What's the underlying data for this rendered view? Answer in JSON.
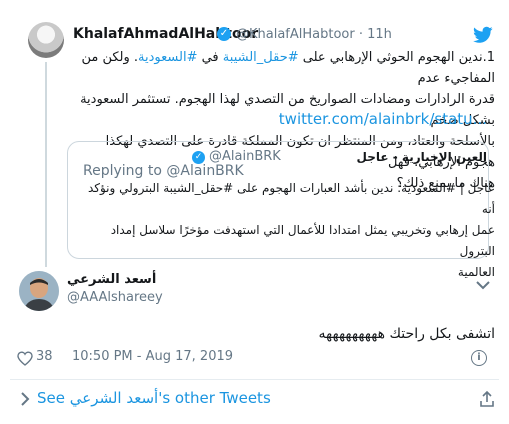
{
  "original_tweet": {
    "author_name": "KhalafAhmadAlHabtoor",
    "verified_mark": "✓",
    "handle_time": "@KhalafAlHabtoor · 11h",
    "text_line1_pre": "1.ندين الهجوم الحوثي الإرهابي على ",
    "text_line1_tag1": "#حقل_الشيبة",
    "text_line1_mid": " في ",
    "text_line1_tag2": "#السعودية",
    "text_line1_post": ". ولكن من المفاجيء عدم",
    "text_line2": "قدرة الرادارات ومضادات الصواريخ من التصدي لهذا الهجوم. تستثمر السعودية بشكل ضخم",
    "text_line3": "بالأسلحة والعتاد، ومن المنتظر ان تكون المملكة قادرة على التصدي لهكذا هجوم الإرهابي. فهل",
    "text_line4": "هناك ما يمنع ذلك؟",
    "link": "twitter.com/alainbrk/statu..."
  },
  "quoted_tweet": {
    "author_name": "العين الإخبارية - عاجل",
    "verified_mark": "✓",
    "handle": "@AlainBRK",
    "replying_to": "Replying to @AlainBRK",
    "text_line1": "عاجل | #السعودية: ندين بأشد العبارات الهجوم على #حقل_الشيبة البترولي ونؤكد أنه",
    "text_line2": "عمل إرهابي وتخريبي يمثل امتدادا للأعمال التي استهدفت مؤخرًا سلاسل إمداد البترول",
    "text_line3": "العالمية"
  },
  "reply_tweet": {
    "author_name": "أسعد الشرعي",
    "handle": "@AAAlshareey",
    "text": "اتشفى بكل راحتك هههههههههه",
    "likes": "38",
    "timestamp": "10:50 PM - Aug 17, 2019",
    "info_glyph": "i"
  },
  "footer": {
    "see_prefix": "See ",
    "see_name": "أسعد الشرعي",
    "see_suffix": "'s other Tweets"
  },
  "colors": {
    "link_blue": "#1b95e0",
    "verified_blue": "#1da1f2",
    "muted_gray": "#657786",
    "border": "#ccd6dd"
  },
  "icons": [
    "twitter-bird-icon",
    "verified-badge-icon",
    "chevron-down-icon",
    "heart-icon",
    "info-icon",
    "chevron-right-icon",
    "share-icon"
  ]
}
